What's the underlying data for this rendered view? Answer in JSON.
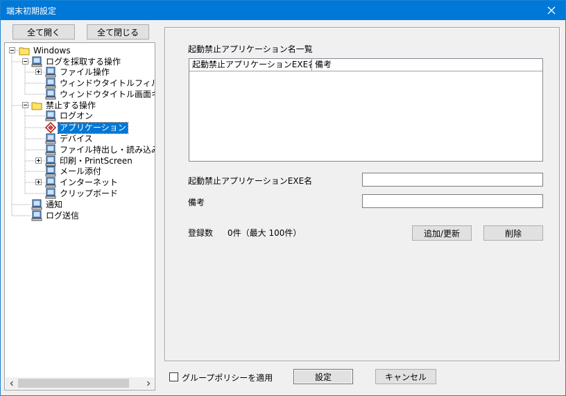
{
  "window": {
    "title": "端末初期設定"
  },
  "toolbar": {
    "expand_all": "全て開く",
    "collapse_all": "全て閉じる"
  },
  "tree": {
    "root": "Windows",
    "log_ops": "ログを採取する操作",
    "file_ops": "ファイル操作",
    "window_title_filter": "ウィンドウタイトルフィルタ",
    "window_title_capture": "ウィンドウタイトル画面キャ",
    "prohibited_ops": "禁止する操作",
    "logon": "ログオン",
    "application": "アプリケーション",
    "device": "デバイス",
    "file_io": "ファイル持出し・読み込み",
    "print_screen": "印刷・PrintScreen",
    "mail_attach": "メール添付",
    "internet": "インターネット",
    "clipboard": "クリップボード",
    "notify": "通知",
    "log_send": "ログ送信"
  },
  "panel": {
    "list_title": "起動禁止アプリケーション名一覧",
    "col_exe": "起動禁止アプリケーションEXE名",
    "col_note": "備考",
    "exe_label": "起動禁止アプリケーションEXE名",
    "exe_value": "",
    "note_label": "備考",
    "note_value": "",
    "count_label": "登録数",
    "count_value": "0件（最大 100件）",
    "add_update": "追加/更新",
    "delete": "削除"
  },
  "footer": {
    "group_policy": "グループポリシーを適用",
    "group_policy_checked": false,
    "ok": "設定",
    "cancel": "キャンセル"
  },
  "colors": {
    "title_bar": "#0078d7",
    "selection": "#0078d7",
    "folder": "#ffe36b"
  }
}
